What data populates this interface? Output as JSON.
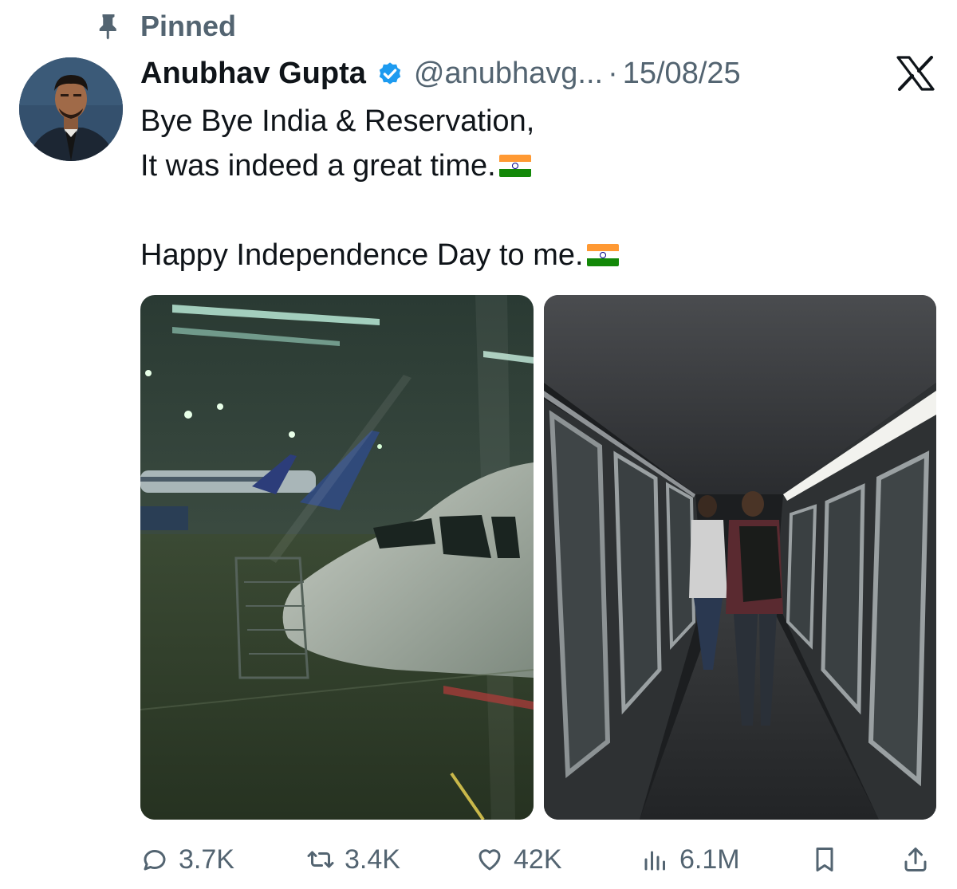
{
  "pinned": {
    "label": "Pinned",
    "icon": "pin-icon"
  },
  "author": {
    "display_name": "Anubhav Gupta",
    "handle": "@anubhavg...",
    "verified": true,
    "verified_color": "#1d9bf0",
    "avatar": "avatar"
  },
  "meta": {
    "separator": "·",
    "date": "15/08/25"
  },
  "platform_logo": "x-logo",
  "tweet": {
    "line1": "Bye Bye India & Reservation,",
    "line2": "It was indeed a great time.",
    "line3": "Happy Independence Day to me."
  },
  "media": [
    {
      "name": "airport-tarmac-photo",
      "description_icon": "photo"
    },
    {
      "name": "jet-bridge-photo",
      "description_icon": "photo"
    }
  ],
  "actions": {
    "reply": {
      "icon": "reply-icon",
      "count": "3.7K"
    },
    "retweet": {
      "icon": "retweet-icon",
      "count": "3.4K"
    },
    "like": {
      "icon": "heart-icon",
      "count": "42K"
    },
    "views": {
      "icon": "views-icon",
      "count": "6.1M"
    },
    "bookmark": {
      "icon": "bookmark-icon"
    },
    "share": {
      "icon": "share-icon"
    }
  },
  "colors": {
    "text": "#0f1419",
    "secondary": "#536471",
    "accent": "#1d9bf0"
  }
}
